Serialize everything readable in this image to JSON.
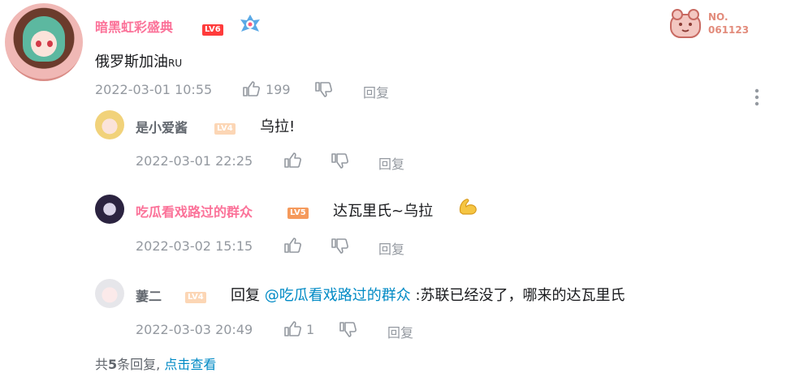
{
  "comment": {
    "username": "暗黑虹彩盛典",
    "level": "LV6",
    "text_main": "俄罗斯加油",
    "text_suffix": "RU",
    "time": "2022-03-01 10:55",
    "likes": "199",
    "reply_label": "回复",
    "badge_no": "NO.",
    "badge_number": "061123"
  },
  "replies": [
    {
      "username": "是小爱酱",
      "level": "LV4",
      "text": "乌拉!",
      "time": "2022-03-01 22:25",
      "likes": "",
      "reply_label": "回复"
    },
    {
      "username": "吃瓜看戏路过的群众",
      "level": "LV5",
      "text": "达瓦里氏~乌拉",
      "time": "2022-03-02 15:15",
      "likes": "",
      "reply_label": "回复"
    },
    {
      "username": "萋二",
      "level": "LV4",
      "reply_prefix": "回复",
      "mention": "@吃瓜看戏路过的群众",
      "text": ":苏联已经没了，哪来的达瓦里氏",
      "time": "2022-03-03 20:49",
      "likes": "1",
      "reply_label": "回复"
    }
  ],
  "footer": {
    "prefix": "共",
    "count": "5",
    "suffix": "条回复,",
    "view_link": "点击查看"
  },
  "colors": {
    "accent_pink": "#fb7299",
    "link_blue": "#008ac5",
    "meta_gray": "#9499a0"
  }
}
